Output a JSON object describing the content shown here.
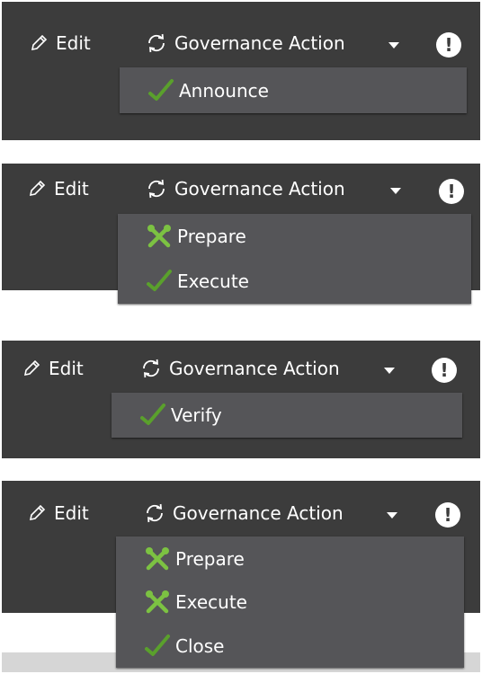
{
  "common": {
    "edit_label": "Edit",
    "action_label": "Governance Action",
    "alert_label": "!"
  },
  "panels": [
    {
      "items": [
        {
          "label": "Announce",
          "icon": "check-icon"
        }
      ]
    },
    {
      "items": [
        {
          "label": "Prepare",
          "icon": "wrench-icon"
        },
        {
          "label": "Execute",
          "icon": "check-icon"
        }
      ]
    },
    {
      "items": [
        {
          "label": "Verify",
          "icon": "check-icon"
        }
      ]
    },
    {
      "items": [
        {
          "label": "Prepare",
          "icon": "wrench-icon"
        },
        {
          "label": "Execute",
          "icon": "wrench-icon"
        },
        {
          "label": "Close",
          "icon": "check-icon"
        }
      ]
    }
  ],
  "colors": {
    "panel_bg": "#3c3c3c",
    "menu_bg": "#555558",
    "check": "#5aa02c",
    "wrench": "#7cc242"
  }
}
